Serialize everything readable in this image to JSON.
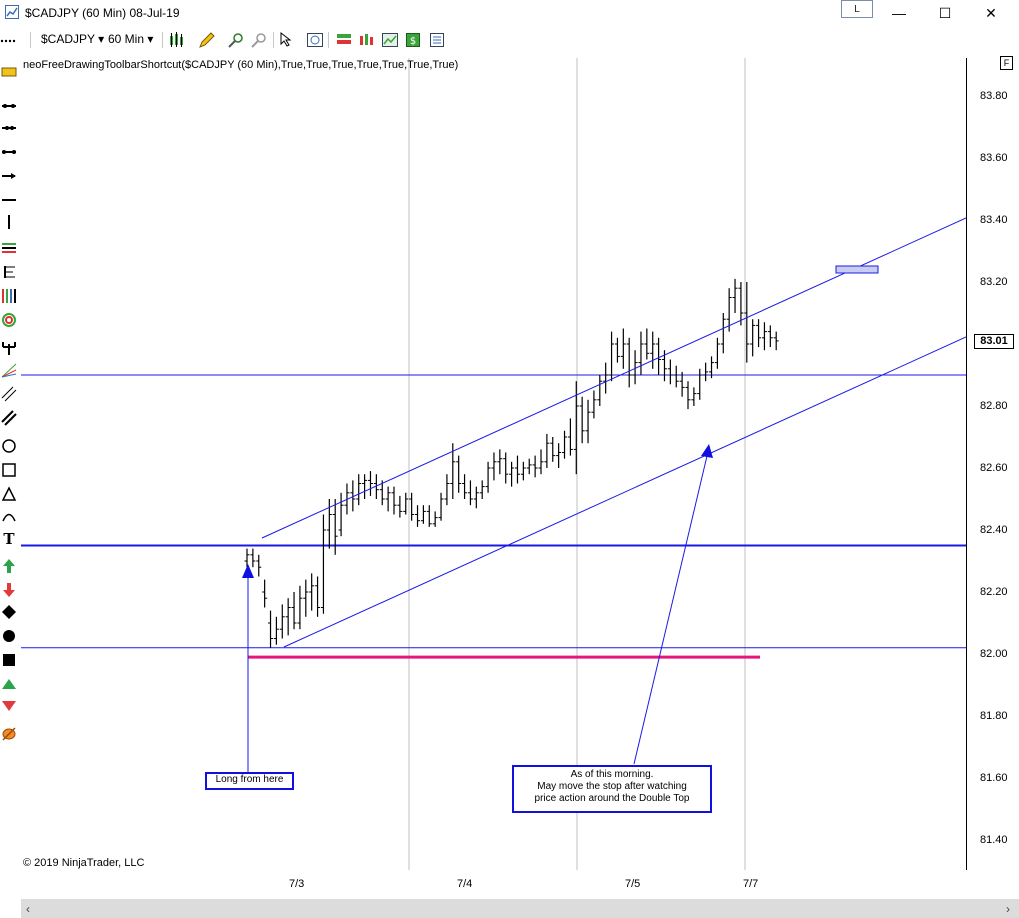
{
  "window": {
    "title": "$CADJPY (60 Min)  08-Jul-19",
    "l_button": "L",
    "minimize": "—",
    "maximize": "☐",
    "close": "✕"
  },
  "toolbar": {
    "instrument": "$CADJPY",
    "interval": "60 Min"
  },
  "indicator_label": "neoFreeDrawingToolbarShortcut($CADJPY (60 Min),True,True,True,True,True,True,True)",
  "copyright": "© 2019 NinjaTrader, LLC",
  "f_box": "F",
  "price_axis": {
    "labels": [
      "83.80",
      "83.60",
      "83.40",
      "83.20",
      "83.00",
      "82.80",
      "82.60",
      "82.40",
      "82.20",
      "82.00",
      "81.80",
      "81.60",
      "81.40"
    ],
    "last_price": "83.01"
  },
  "time_axis": {
    "labels": [
      "7/3",
      "7/4",
      "7/5",
      "7/7"
    ]
  },
  "annotations": {
    "long_label": "Long from here",
    "morning_note_line1": "As of this morning.",
    "morning_note_line2": "May move the stop after watching",
    "morning_note_line3": "price action around the Double Top"
  },
  "colors": {
    "channel": "#1a1ae6",
    "horizontal_line": "#1a1ae6",
    "stop_line": "#e8157c",
    "bars": "#000000",
    "double_top_marker": "#c8ccf0"
  },
  "chart_data": {
    "type": "ohlc",
    "symbol": "$CADJPY",
    "interval": "60 Min",
    "ylim": [
      81.34,
      83.98
    ],
    "y_ticks": [
      83.8,
      83.6,
      83.4,
      83.2,
      83.0,
      82.8,
      82.6,
      82.4,
      82.2,
      82.0,
      81.8,
      81.6,
      81.4
    ],
    "x_tick_labels": [
      "7/3",
      "7/4",
      "7/5",
      "7/7"
    ],
    "last_price": 83.01,
    "horizontal_lines": [
      82.9,
      82.35,
      82.02
    ],
    "stop_level": 81.99,
    "bars": [
      [
        82.3,
        82.34,
        82.28,
        82.32
      ],
      [
        82.32,
        82.34,
        82.28,
        82.3
      ],
      [
        82.3,
        82.32,
        82.25,
        82.28
      ],
      [
        82.2,
        82.24,
        82.15,
        82.18
      ],
      [
        82.1,
        82.14,
        82.02,
        82.05
      ],
      [
        82.05,
        82.12,
        82.03,
        82.08
      ],
      [
        82.08,
        82.16,
        82.05,
        82.12
      ],
      [
        82.12,
        82.18,
        82.06,
        82.15
      ],
      [
        82.15,
        82.2,
        82.08,
        82.1
      ],
      [
        82.1,
        82.22,
        82.08,
        82.18
      ],
      [
        82.18,
        82.24,
        82.12,
        82.2
      ],
      [
        82.2,
        82.26,
        82.14,
        82.22
      ],
      [
        82.22,
        82.25,
        82.12,
        82.15
      ],
      [
        82.15,
        82.45,
        82.13,
        82.4
      ],
      [
        82.4,
        82.5,
        82.34,
        82.45
      ],
      [
        82.45,
        82.5,
        82.32,
        82.38
      ],
      [
        82.4,
        82.52,
        82.38,
        82.48
      ],
      [
        82.48,
        82.55,
        82.45,
        82.52
      ],
      [
        82.52,
        82.56,
        82.46,
        82.5
      ],
      [
        82.5,
        82.58,
        82.48,
        82.55
      ],
      [
        82.55,
        82.58,
        82.5,
        82.56
      ],
      [
        82.56,
        82.59,
        82.51,
        82.55
      ],
      [
        82.55,
        82.58,
        82.5,
        82.53
      ],
      [
        82.53,
        82.56,
        82.48,
        82.5
      ],
      [
        82.5,
        82.54,
        82.46,
        82.52
      ],
      [
        82.52,
        82.54,
        82.45,
        82.48
      ],
      [
        82.48,
        82.51,
        82.44,
        82.46
      ],
      [
        82.46,
        82.52,
        82.45,
        82.5
      ],
      [
        82.5,
        82.52,
        82.43,
        82.45
      ],
      [
        82.45,
        82.48,
        82.41,
        82.43
      ],
      [
        82.43,
        82.48,
        82.42,
        82.46
      ],
      [
        82.46,
        82.48,
        82.41,
        82.42
      ],
      [
        82.42,
        82.46,
        82.41,
        82.44
      ],
      [
        82.44,
        82.52,
        82.43,
        82.5
      ],
      [
        82.5,
        82.58,
        82.48,
        82.55
      ],
      [
        82.55,
        82.68,
        82.5,
        82.62
      ],
      [
        82.62,
        82.64,
        82.52,
        82.55
      ],
      [
        82.55,
        82.58,
        82.5,
        82.52
      ],
      [
        82.52,
        82.56,
        82.48,
        82.5
      ],
      [
        82.5,
        82.54,
        82.47,
        82.52
      ],
      [
        82.52,
        82.56,
        82.5,
        82.54
      ],
      [
        82.54,
        82.62,
        82.52,
        82.6
      ],
      [
        82.6,
        82.65,
        82.56,
        82.62
      ],
      [
        82.62,
        82.66,
        82.58,
        82.63
      ],
      [
        82.63,
        82.65,
        82.55,
        82.58
      ],
      [
        82.58,
        82.62,
        82.54,
        82.6
      ],
      [
        82.6,
        82.64,
        82.55,
        82.58
      ],
      [
        82.58,
        82.62,
        82.56,
        82.6
      ],
      [
        82.6,
        82.63,
        82.58,
        82.61
      ],
      [
        82.61,
        82.64,
        82.57,
        82.6
      ],
      [
        82.6,
        82.66,
        82.58,
        82.62
      ],
      [
        82.62,
        82.71,
        82.6,
        82.68
      ],
      [
        82.68,
        82.7,
        82.62,
        82.64
      ],
      [
        82.64,
        82.68,
        82.6,
        82.65
      ],
      [
        82.65,
        82.72,
        82.63,
        82.7
      ],
      [
        82.7,
        82.76,
        82.64,
        82.66
      ],
      [
        82.66,
        82.88,
        82.58,
        82.8
      ],
      [
        82.8,
        82.83,
        82.68,
        82.72
      ],
      [
        82.72,
        82.82,
        82.68,
        82.78
      ],
      [
        82.78,
        82.85,
        82.76,
        82.82
      ],
      [
        82.82,
        82.9,
        82.8,
        82.88
      ],
      [
        82.88,
        82.94,
        82.84,
        82.9
      ],
      [
        82.9,
        83.04,
        82.88,
        83.0
      ],
      [
        83.0,
        83.02,
        82.94,
        82.96
      ],
      [
        82.96,
        83.05,
        82.92,
        83.0
      ],
      [
        83.0,
        83.02,
        82.86,
        82.9
      ],
      [
        82.9,
        82.98,
        82.87,
        82.94
      ],
      [
        82.94,
        83.04,
        82.9,
        83.0
      ],
      [
        83.0,
        83.05,
        82.95,
        82.97
      ],
      [
        82.97,
        83.04,
        82.92,
        83.0
      ],
      [
        83.0,
        83.02,
        82.9,
        82.95
      ],
      [
        82.95,
        82.98,
        82.88,
        82.92
      ],
      [
        82.92,
        82.95,
        82.87,
        82.9
      ],
      [
        82.9,
        82.93,
        82.86,
        82.88
      ],
      [
        82.88,
        82.91,
        82.83,
        82.86
      ],
      [
        82.86,
        82.88,
        82.79,
        82.82
      ],
      [
        82.82,
        82.86,
        82.8,
        82.84
      ],
      [
        82.84,
        82.92,
        82.82,
        82.9
      ],
      [
        82.9,
        82.94,
        82.88,
        82.91
      ],
      [
        82.91,
        82.96,
        82.89,
        82.94
      ],
      [
        82.94,
        83.02,
        82.92,
        83.0
      ],
      [
        83.0,
        83.1,
        82.97,
        83.08
      ],
      [
        83.08,
        83.18,
        83.04,
        83.15
      ],
      [
        83.15,
        83.21,
        83.1,
        83.18
      ],
      [
        83.18,
        83.2,
        83.06,
        83.1
      ],
      [
        83.1,
        83.2,
        82.94,
        83.0
      ],
      [
        83.0,
        83.08,
        82.96,
        83.06
      ],
      [
        83.06,
        83.08,
        82.99,
        83.02
      ],
      [
        83.02,
        83.07,
        82.98,
        83.04
      ],
      [
        83.04,
        83.06,
        82.99,
        83.02
      ],
      [
        83.02,
        83.04,
        82.98,
        83.01
      ]
    ]
  }
}
